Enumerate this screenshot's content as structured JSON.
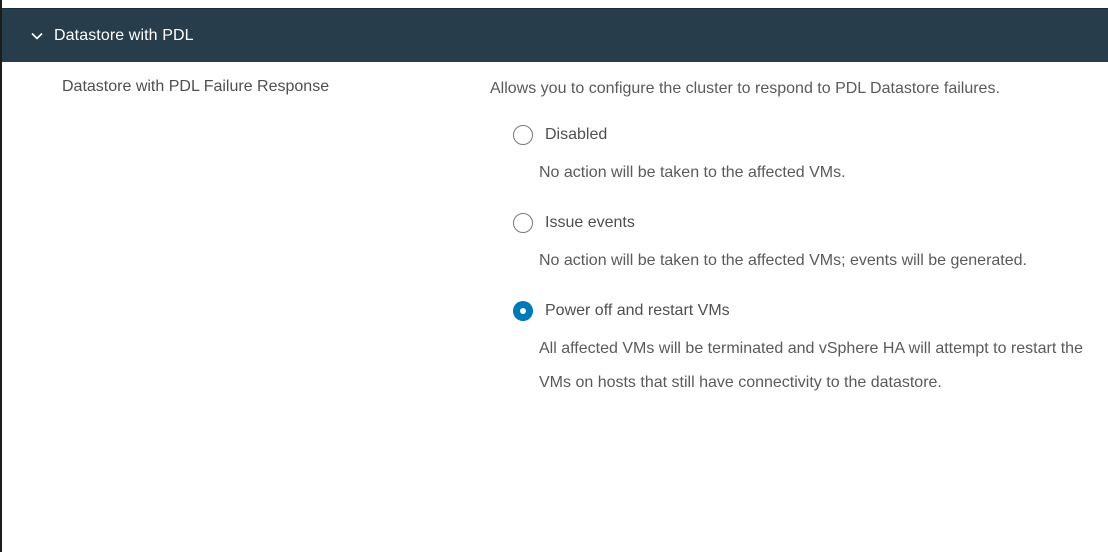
{
  "section": {
    "title": "Datastore with PDL",
    "chevron_icon": "chevron-down-icon"
  },
  "setting": {
    "label": "Datastore with PDL Failure Response",
    "description": "Allows you to configure the cluster to respond to PDL Datastore failures."
  },
  "options": [
    {
      "label": "Disabled",
      "description": "No action will be taken to the affected VMs.",
      "selected": false
    },
    {
      "label": "Issue events",
      "description": "No action will be taken to the affected VMs; events will be generated.",
      "selected": false
    },
    {
      "label": "Power off and restart VMs",
      "description": "All affected VMs will be terminated and vSphere HA will attempt to restart the VMs on hosts that still have connectivity to the datastore.",
      "selected": true
    }
  ],
  "colors": {
    "header_bg": "#283d4c",
    "accent": "#0079b8"
  }
}
